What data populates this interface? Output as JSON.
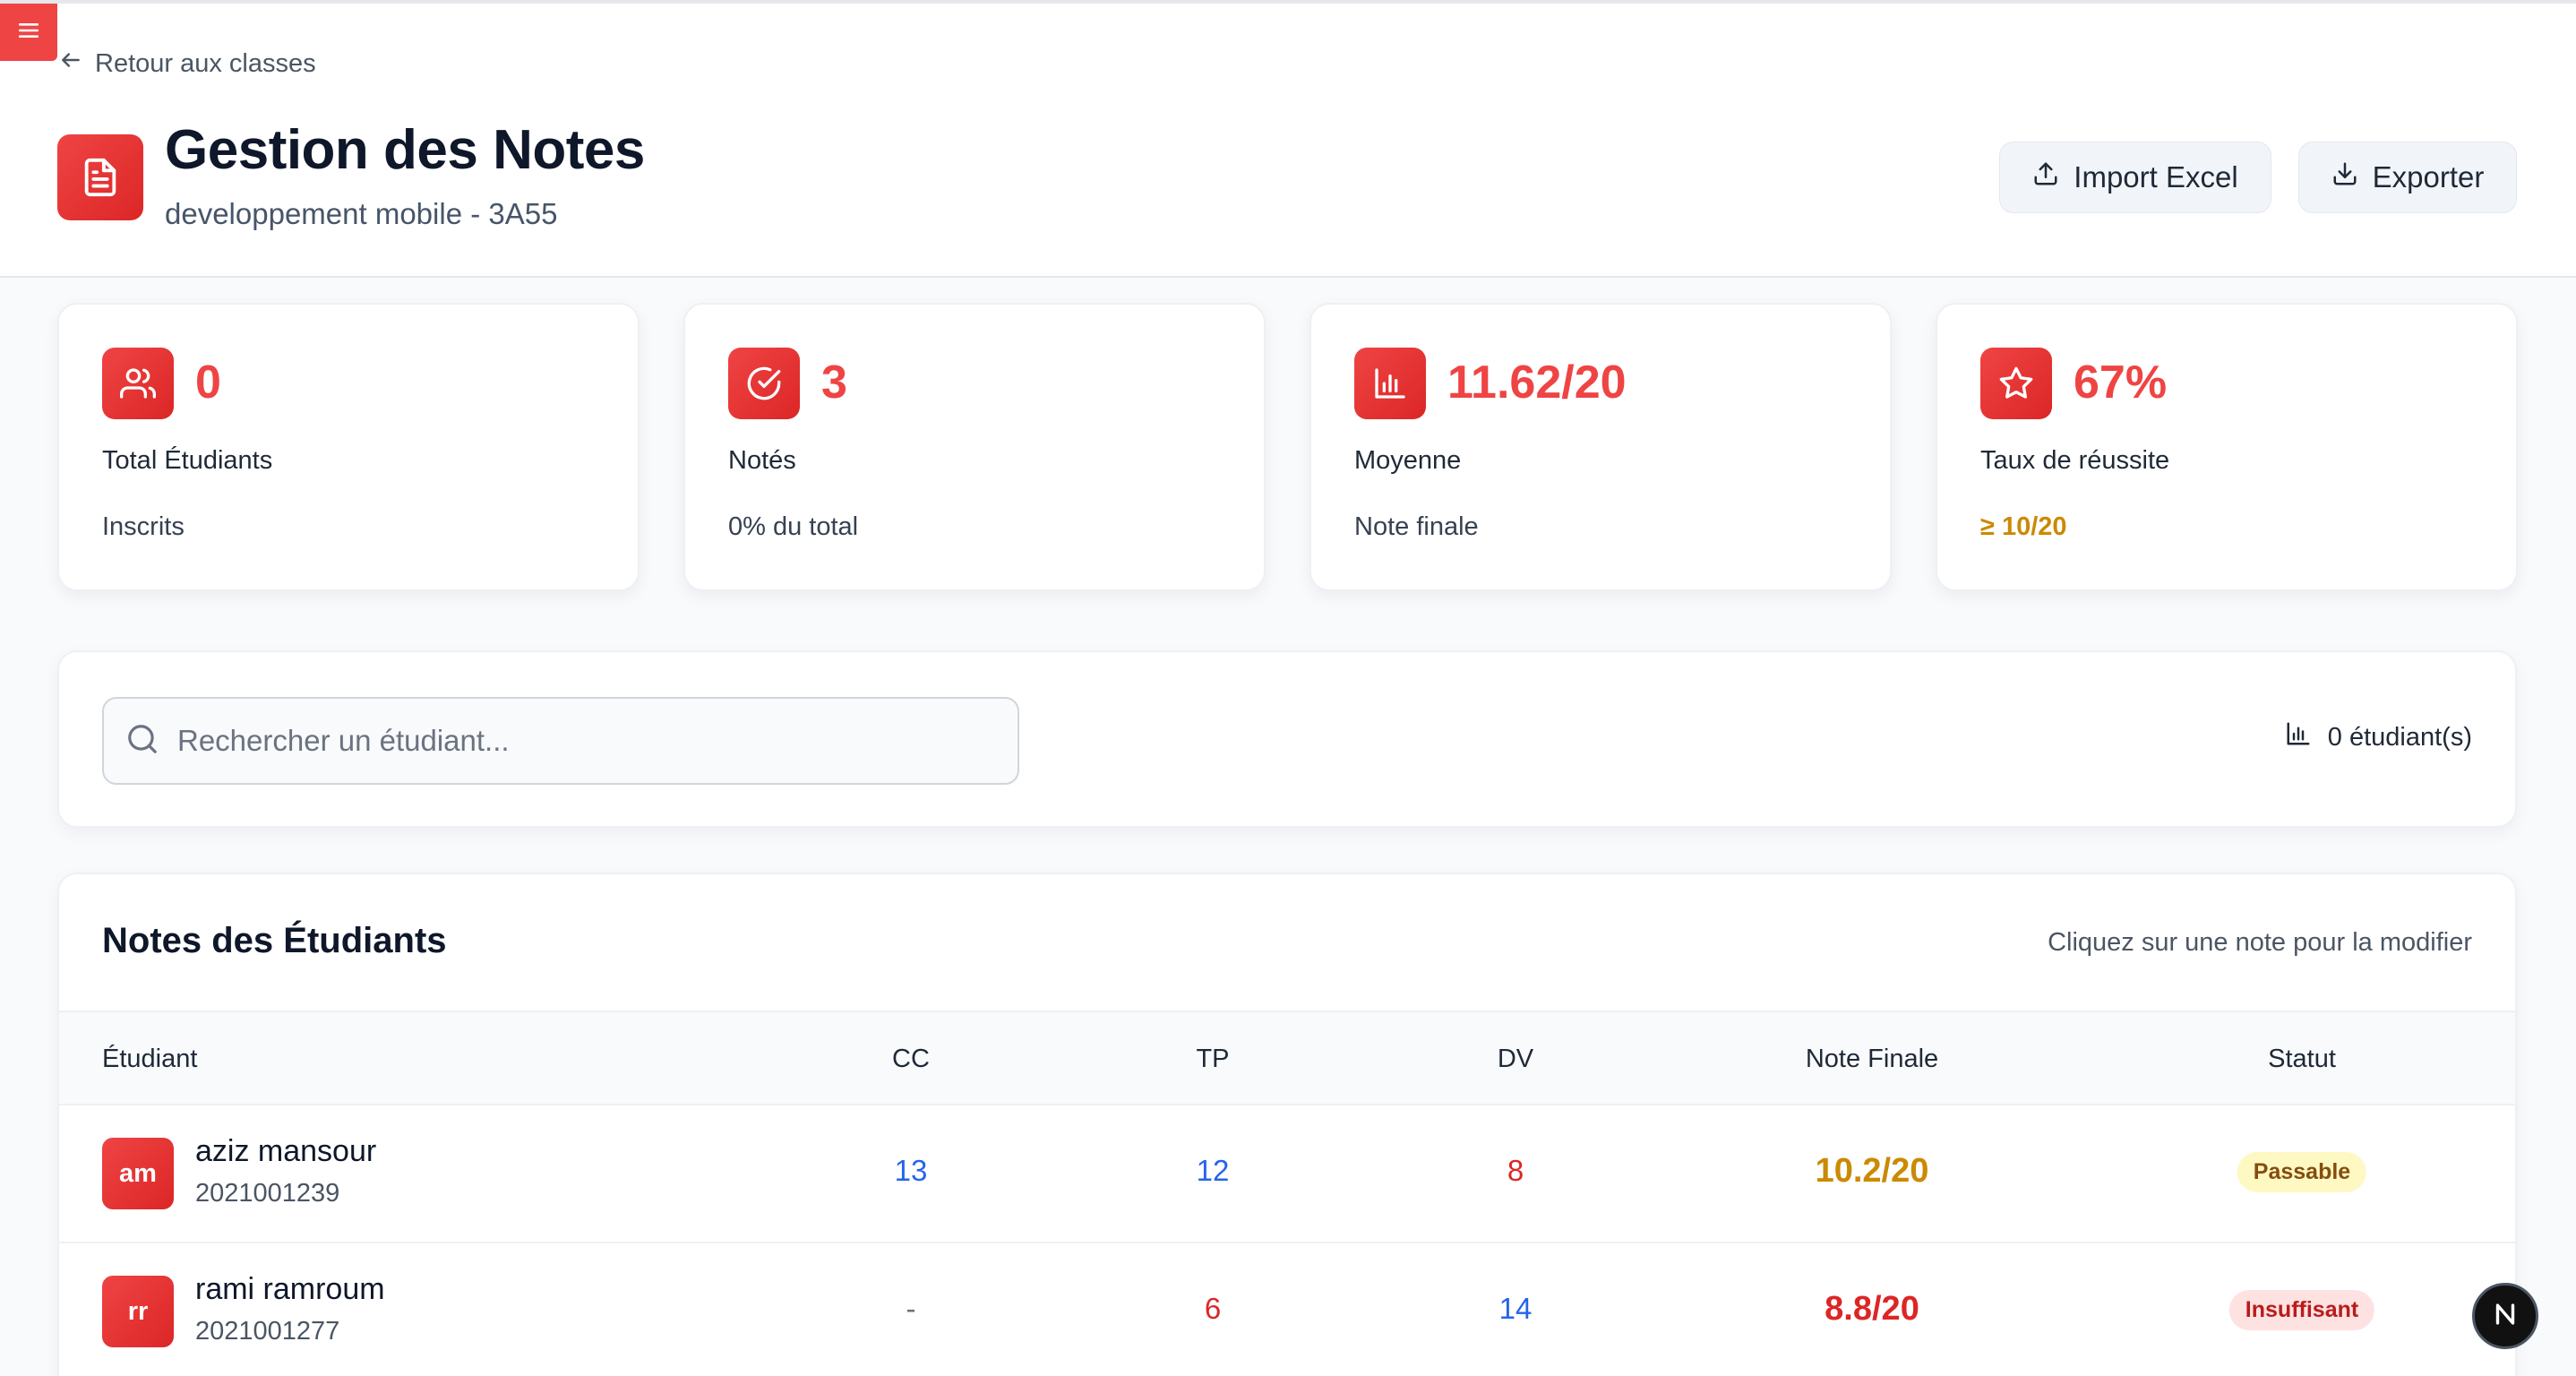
{
  "header": {
    "menu_icon": "hamburger-icon",
    "back_label": "Retour aux classes",
    "title": "Gestion des Notes",
    "subtitle": "developpement mobile - 3A55",
    "import_label": "Import Excel",
    "export_label": "Exporter"
  },
  "stats": [
    {
      "icon": "users-icon",
      "value": "0",
      "label": "Total Étudiants",
      "sub": "Inscrits"
    },
    {
      "icon": "check-circle-icon",
      "value": "3",
      "label": "Notés",
      "sub": "0% du total"
    },
    {
      "icon": "bar-chart-icon",
      "value": "11.62/20",
      "label": "Moyenne",
      "sub": "Note finale"
    },
    {
      "icon": "star-icon",
      "value": "67%",
      "label": "Taux de réussite",
      "sub": "≥ 10/20"
    }
  ],
  "search": {
    "placeholder": "Rechercher un étudiant...",
    "value": "",
    "count_label": "0 étudiant(s)"
  },
  "table": {
    "title": "Notes des Étudiants",
    "hint": "Cliquez sur une note pour la modifier",
    "columns": [
      "Étudiant",
      "CC",
      "TP",
      "DV",
      "Note Finale",
      "Statut"
    ],
    "rows": [
      {
        "initials": "am",
        "name": "aziz mansour",
        "id": "2021001239",
        "cc": "13",
        "tp": "12",
        "dv": "8",
        "final": "10.2/20",
        "status": "Passable"
      },
      {
        "initials": "rr",
        "name": "rami ramroum",
        "id": "2021001277",
        "cc": "-",
        "tp": "6",
        "dv": "14",
        "final": "8.8/20",
        "status": "Insuffisant"
      }
    ]
  },
  "colors": {
    "accent": "#ef4444",
    "grade_good": "#2563eb",
    "grade_bad": "#dc2626",
    "grade_empty": "#6b7280",
    "final_passable": "#ca8a04",
    "final_fail": "#dc2626",
    "badge_passable_bg": "#fef9c3",
    "badge_passable_fg": "#854d0e",
    "badge_fail_bg": "#fee2e2",
    "badge_fail_fg": "#b91c1c"
  },
  "floating_button": {
    "icon": "next-logo-icon"
  }
}
